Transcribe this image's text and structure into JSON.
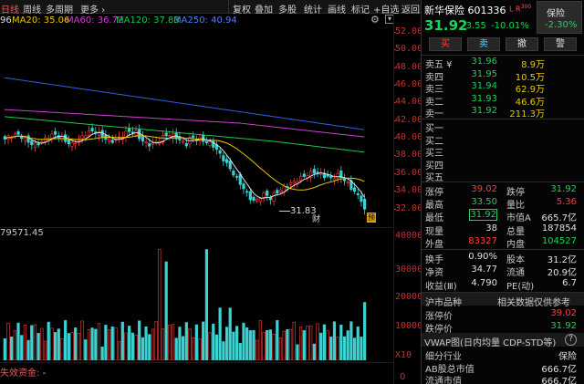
{
  "toolbar": {
    "tabs": [
      {
        "label": "日线",
        "active": true
      },
      {
        "label": "周线"
      },
      {
        "label": "多周期"
      },
      {
        "label": "更多 ›"
      }
    ],
    "tools": [
      "复权",
      "叠加",
      "多股",
      "统计",
      "画线",
      "标记",
      "+自选",
      "返回"
    ]
  },
  "legend": {
    "ma5": "96",
    "ma20": "MA20: 35.06",
    "ma60": "MA60: 36.72",
    "ma120": "MA120: 37.83",
    "ma250": "MA250: 40.94"
  },
  "price_axis": [
    "52.00",
    "50.00",
    "48.00",
    "46.00",
    "44.00",
    "42.00",
    "40.00",
    "38.00",
    "36.00",
    "34.00",
    "32.00"
  ],
  "low_label": "31.83",
  "cai_marker": "财",
  "yu_marker": "预",
  "vol_label": "79571.45",
  "vol_axis": [
    "40000",
    "30000",
    "20000",
    "10000",
    "X10"
  ],
  "fund_label": "失效资金:",
  "fund_value": "-",
  "stock": {
    "name": "新华保险",
    "code": "601336",
    "badge": "L R",
    "badge_sub": "300",
    "price": "31.92",
    "change": "-3.55",
    "pct": "-10.01%",
    "sector": "保险",
    "sector_pct": "-2.30%"
  },
  "trade_buttons": [
    "买",
    "卖",
    "撤",
    "警"
  ],
  "asks": [
    {
      "label": "卖五 ¥",
      "price": "31.96",
      "vol": "8.9万"
    },
    {
      "label": "卖四",
      "price": "31.95",
      "vol": "10.5万"
    },
    {
      "label": "卖三",
      "price": "31.94",
      "vol": "62.9万"
    },
    {
      "label": "卖二",
      "price": "31.93",
      "vol": "46.6万"
    },
    {
      "label": "卖一",
      "price": "31.92",
      "vol": "211.3万"
    }
  ],
  "bids": [
    "买一",
    "买二",
    "买三",
    "买四",
    "买五"
  ],
  "quote_rows": [
    {
      "l1": "涨停",
      "v1": "39.02",
      "c1": "r",
      "l2": "跌停",
      "v2": "31.92",
      "c2": "g"
    },
    {
      "l1": "最高",
      "v1": "33.50",
      "c1": "g",
      "l2": "量比",
      "v2": "5.36",
      "c2": "r"
    },
    {
      "l1": "最低",
      "v1": "31.92",
      "c1": "g",
      "l2": "市值A",
      "v2": "665.7亿",
      "c2": "w",
      "boxed": true
    },
    {
      "l1": "现量",
      "v1": "38",
      "c1": "w",
      "l2": "总量",
      "v2": "187854",
      "c2": "w"
    },
    {
      "l1": "外盘",
      "v1": "83327",
      "c1": "r",
      "l2": "内盘",
      "v2": "104527",
      "c2": "g"
    }
  ],
  "fin_rows": [
    {
      "l1": "换手",
      "v1": "0.90%",
      "l2": "股本",
      "v2": "31.2亿"
    },
    {
      "l1": "净资",
      "v1": "34.77",
      "l2": "流通",
      "v2": "20.9亿"
    },
    {
      "l1": "收益(Ⅲ)",
      "v1": "4.790",
      "l2": "PE(动)",
      "v2": "6.7"
    }
  ],
  "hs_section": {
    "label": "沪市品种",
    "note": "相关数据仅供参考"
  },
  "limit_rows": [
    {
      "label": "涨停价",
      "value": "39.02"
    },
    {
      "label": "跌停价",
      "value": "31.92"
    }
  ],
  "vwap": {
    "label": "VWAP图(日内均量 CDP-STD等)",
    "question": "?"
  },
  "sector_rows": [
    {
      "label": "细分行业",
      "value": "保险"
    },
    {
      "label": "AB股总市值",
      "value": "666.7亿"
    },
    {
      "label": "流通市值",
      "value": "666.7亿"
    }
  ],
  "chart_data": {
    "type": "candlestick",
    "price_range": [
      31,
      53
    ],
    "volume_range": [
      0,
      40000
    ],
    "candles": [],
    "ma_lines": [
      "MA5",
      "MA20",
      "MA60",
      "MA120",
      "MA250"
    ]
  },
  "colors": {
    "up": "#ff3c3c",
    "down": "#3cd2d2",
    "ma5": "#e0e0e0",
    "ma20": "#e8c800",
    "ma60": "#d040d0",
    "ma120": "#19c850",
    "ma250": "#3060e0"
  }
}
